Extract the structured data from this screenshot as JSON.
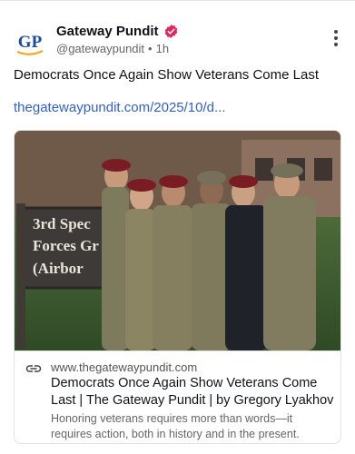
{
  "author": {
    "logo_text": "GP",
    "display_name": "Gateway Pundit",
    "handle": "@gatewaypundit",
    "separator": "•",
    "time": "1h",
    "verified_icon": "verified-badge-icon"
  },
  "post": {
    "text": "Democrats Once Again Show Veterans Come Last",
    "link": "thegatewaypundit.com/2025/10/d..."
  },
  "card": {
    "image_sign_lines": [
      "3rd Spec",
      "Forces Gr",
      "(Airbor"
    ],
    "domain": "www.thegatewaypundit.com",
    "title": "Democrats Once Again Show Veterans Come Last | The Gateway Pundit | by Gregory Lyakhov",
    "description": "Honoring veterans requires more than words—it requires action, both in history and in the present."
  },
  "colors": {
    "link": "#2e5fd6",
    "verified": "#e0245e",
    "logo_blue": "#1b4aa3",
    "logo_orange": "#f5a623"
  }
}
